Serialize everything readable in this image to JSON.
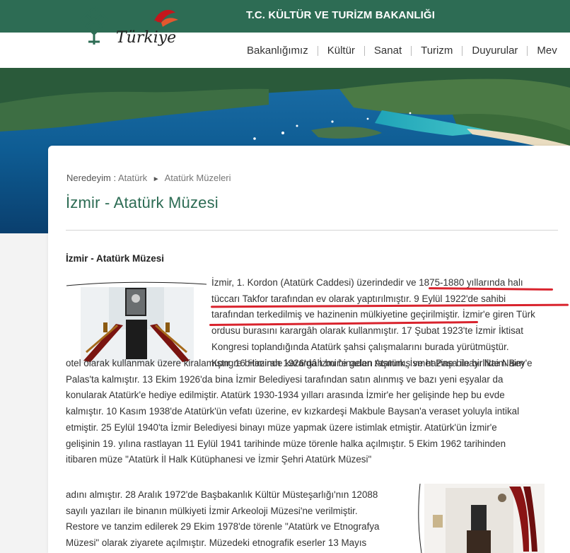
{
  "header": {
    "ministry": "T.C. KÜLTÜR VE TURİZM BAKANLIĞI",
    "brand_logo_text": "Türkiye"
  },
  "nav": {
    "items": [
      "Bakanlığımız",
      "Kültür",
      "Sanat",
      "Turizm",
      "Duyurular",
      "Mev"
    ]
  },
  "breadcrumb": {
    "label": "Neredeyim :",
    "items": [
      "Atatürk",
      "Atatürk Müzeleri"
    ],
    "separator": "►"
  },
  "page": {
    "title": "İzmir - Atatürk Müzesi",
    "subheading": "İzmir - Atatürk Müzesi"
  },
  "article": {
    "lines_top": [
      "İzmir, 1. Kordon (Atatürk Caddesi) üzerindedir ve 1875-1880 yıllarında halı",
      "tüccarı Takfor tarafından ev olarak yaptırılmıştır. 9 Eylül 1922'de sahibi",
      "tarafından terkedilmiş ve hazinenin mülkiyetine geçirilmiştir. İzmir'e giren Türk",
      "ordusu burasını karargâh olarak kullanmıştır. 17 Şubat 1923'te İzmir İktisat",
      "Kongresi toplandığında Atatürk şahsi çalışmalarını burada yürütmüştür.",
      "Kongre bitiminde karargâh bu binadan taşınmış ve hazine binayı Naim Bey'e"
    ],
    "lines_mid": [
      "otel olarak kullanmak üzere kiralamıştır. 16 Haziran 1926'da İzmir'e gelen Atatürk, İsmet Paşa ile birlikte Naim",
      "Palas'ta kalmıştır. 13 Ekim 1926'da bina İzmir Belediyesi tarafından satın alınmış ve bazı yeni eşyalar da",
      "konularak Atatürk'e hediye edilmiştir. Atatürk 1930-1934 yılları arasında İzmir'e her gelişinde hep bu evde",
      "kalmıştır. 10 Kasım 1938'de Atatürk'ün vefatı üzerine, ev kızkardeşi Makbule Baysan'a veraset yoluyla intikal",
      "etmiştir. 25 Eylül 1940'ta İzmir Belediyesi binayı müze yapmak üzere istimlak etmiştir. Atatürk'ün İzmir'e",
      "gelişinin 19. yılına rastlayan 11 Eylül 1941 tarihinde müze törenle halka açılmıştır. 5 Ekim 1962 tarihinden",
      "itibaren müze \"Atatürk İl Halk Kütüphanesi ve İzmir Şehri Atatürk Müzesi\""
    ],
    "lines_bottom": [
      "adını almıştır. 28 Aralık 1972'de Başbakanlık Kültür Müsteşarlığı'nın 12088",
      "sayılı yazıları ile binanın mülkiyeti İzmir Arkeoloji Müzesi'ne verilmiştir.",
      "Restore ve tanzim edilerek 29 Ekim 1978'de törenle \"Atatürk ve Etnografya",
      "Müzesi\" olarak ziyarete açılmıştır. Müzedeki etnografik eserler 13 Mayıs"
    ]
  },
  "colors": {
    "brand_green": "#2d6c54",
    "highlight_red": "#d9232d"
  }
}
